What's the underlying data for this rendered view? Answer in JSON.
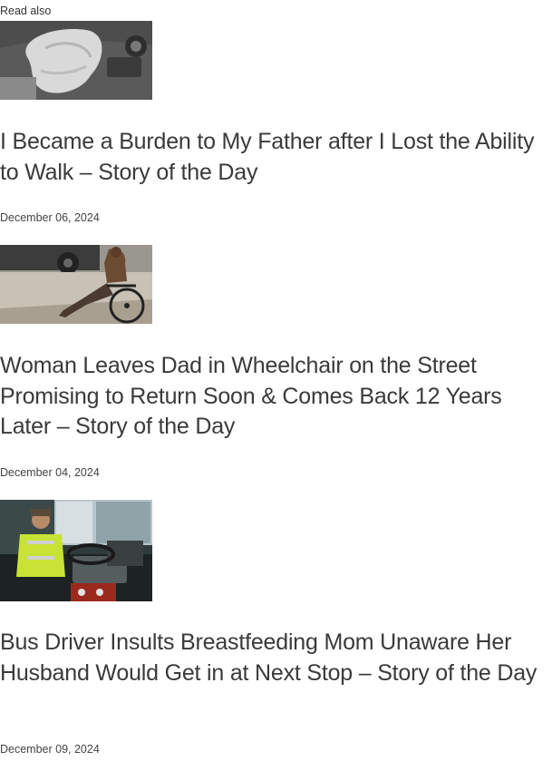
{
  "section_label": "Read also",
  "articles": [
    {
      "title": "I Became a Burden to My Father after I Lost the Ability to Walk – Story of the Day",
      "date": "December 06, 2024",
      "image_icon": "car-airbag-photo"
    },
    {
      "title": "Woman Leaves Dad in Wheelchair on the Street Promising to Return Soon & Comes Back 12 Years Later – Story of the Day",
      "date": "December 04, 2024",
      "image_icon": "wheelchair-street-photo"
    },
    {
      "title": "Bus Driver Insults Breastfeeding Mom Unaware Her Husband Would Get in at Next Stop – Story of the Day",
      "date": "December 09, 2024",
      "image_icon": "bus-driver-photo"
    }
  ]
}
